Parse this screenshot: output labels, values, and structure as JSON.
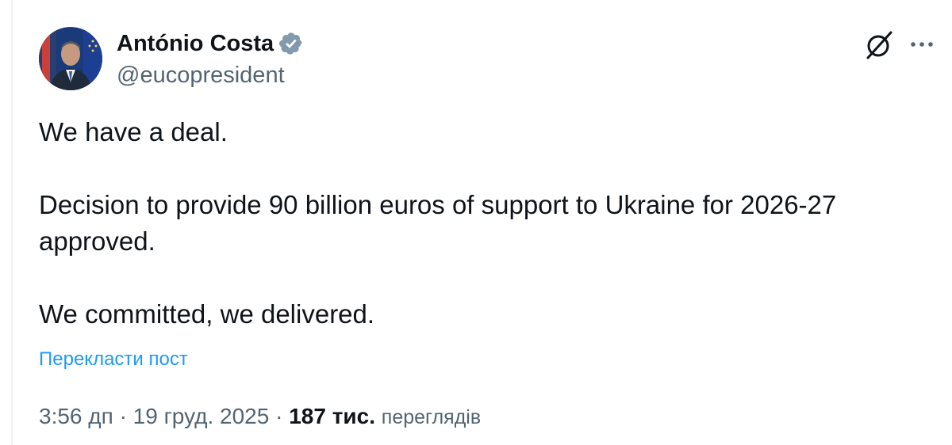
{
  "author": {
    "name": "António Costa",
    "handle": "@eucopresident",
    "verified": true,
    "badge_color": "#829aab"
  },
  "actions": {
    "grok_icon": "grok-icon",
    "more_icon": "more-horizontal-icon"
  },
  "tweet": {
    "paragraphs": [
      "We have a deal.",
      "Decision to provide 90 billion euros of support to Ukraine for 2026-27 approved.",
      "We committed, we delivered."
    ]
  },
  "translate_label": "Перекласти пост",
  "meta": {
    "time": "3:56 дп",
    "separator": "·",
    "date": "19 груд. 2025",
    "views_count": "187 тис.",
    "views_label": "переглядів"
  },
  "colors": {
    "text": "#0f1419",
    "secondary": "#536471",
    "link": "#1d9bf0"
  }
}
